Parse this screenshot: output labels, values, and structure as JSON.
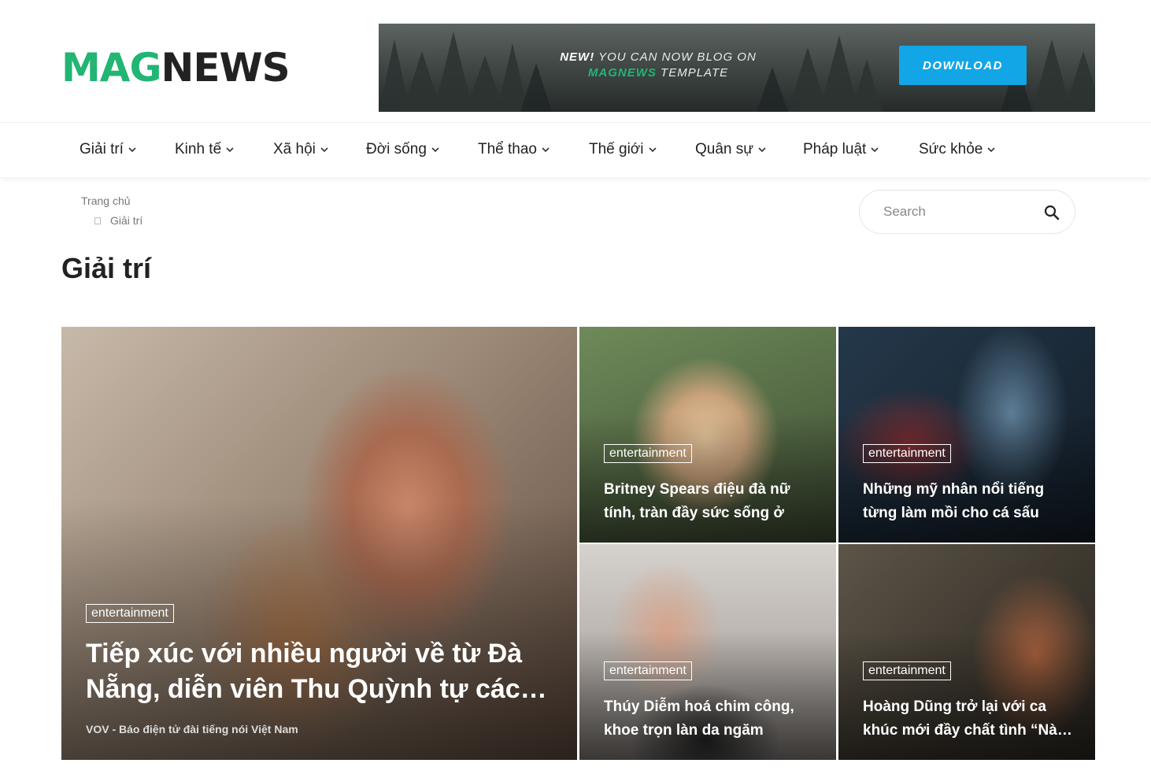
{
  "logo": {
    "part1": "MAG",
    "part2": "NEWS"
  },
  "banner": {
    "text_new": "NEW!",
    "text_line1": " YOU CAN NOW BLOG ON",
    "text_brand": "MAGNEWS",
    "text_line2": " TEMPLATE",
    "button": "DOWNLOAD",
    "button_color": "#12a6e6"
  },
  "nav": {
    "items": [
      {
        "label": "Giải trí"
      },
      {
        "label": "Kinh tế"
      },
      {
        "label": "Xã hội"
      },
      {
        "label": "Đời sống"
      },
      {
        "label": "Thể thao"
      },
      {
        "label": "Thế giới"
      },
      {
        "label": "Quân sự"
      },
      {
        "label": "Pháp luật"
      },
      {
        "label": "Sức khỏe"
      }
    ]
  },
  "breadcrumb": {
    "home": "Trang chủ",
    "current": "Giải trí"
  },
  "search": {
    "placeholder": "Search",
    "icon": "search-icon"
  },
  "page_title": "Giải trí",
  "colors": {
    "brand_green": "#22b573",
    "text_dark": "#222222"
  },
  "featured": {
    "tag": "entertainment",
    "title": "Tiếp xúc với nhiều người về từ Đà Nẵng, diễn viên Thu Quỳnh tự các…",
    "source": "VOV - Báo điện tử đài tiếng nói Việt Nam"
  },
  "articles": [
    {
      "tag": "entertainment",
      "title": "Britney Spears điệu đà nữ tính, tràn đầy sức sống ở tu…"
    },
    {
      "tag": "entertainment",
      "title": "Những mỹ nhân nổi tiếng từng làm mồi cho cá sấu trê…"
    },
    {
      "tag": "entertainment",
      "title": "Thúy Diễm hoá chim công, khoe trọn làn da ngăm quyế…"
    },
    {
      "tag": "entertainment",
      "title": "Hoàng Dũng trở lại với ca khúc mới đầy chất tình “Nà…"
    }
  ]
}
